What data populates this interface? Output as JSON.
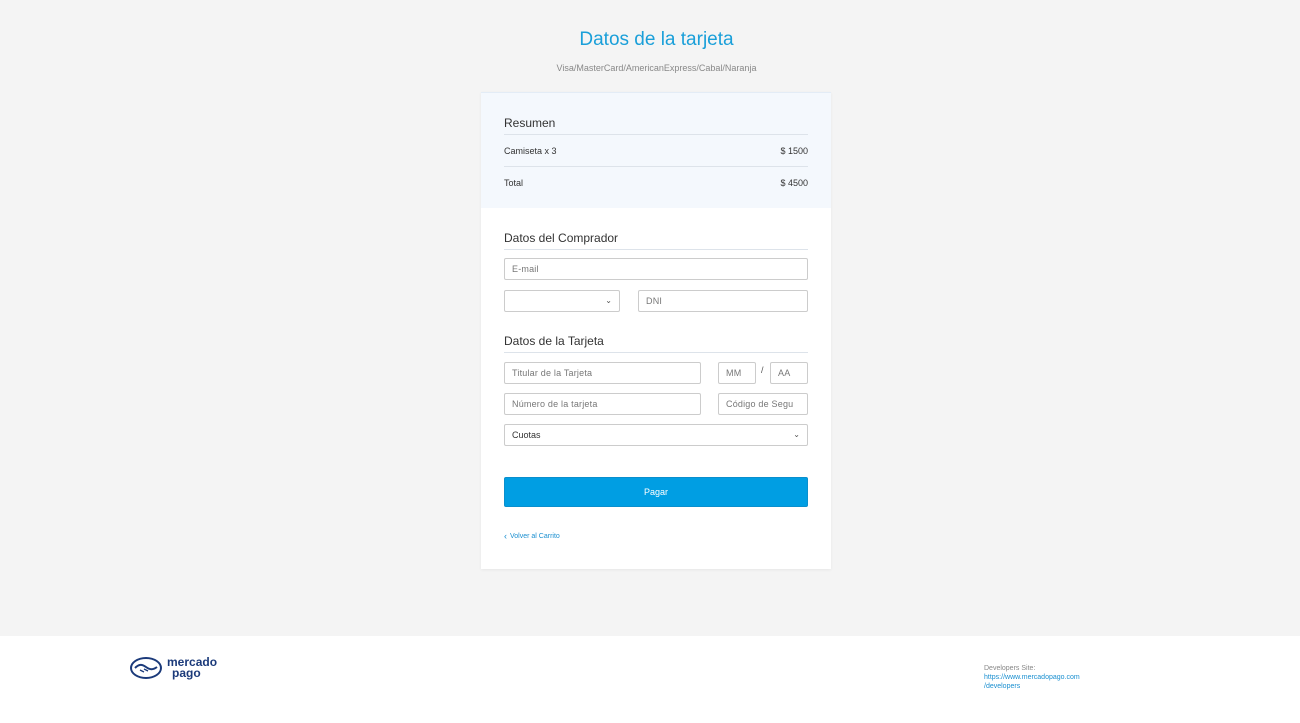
{
  "header": {
    "title": "Datos de la tarjeta",
    "subtitle": "Visa/MasterCard/AmericanExpress/Cabal/Naranja"
  },
  "summary": {
    "title": "Resumen",
    "item_label": "Camiseta x 3",
    "item_value": "$ 1500",
    "total_label": "Total",
    "total_value": "$ 4500"
  },
  "buyer": {
    "title": "Datos del Comprador",
    "email_placeholder": "E-mail",
    "doc_type_value": "",
    "dni_placeholder": "DNI"
  },
  "card": {
    "title": "Datos de la Tarjeta",
    "holder_placeholder": "Titular de la Tarjeta",
    "month_placeholder": "MM",
    "slash": "/",
    "year_placeholder": "AA",
    "number_placeholder": "Número de la tarjeta",
    "cvv_placeholder": "Código de Segu",
    "installments_value": "Cuotas"
  },
  "actions": {
    "pay_label": "Pagar",
    "back_label": "Volver al Carrito"
  },
  "footer": {
    "logo_line1": "mercado",
    "logo_line2": "pago",
    "dev_label": "Developers Site:",
    "dev_url_line1": "https://www.mercadopago.com",
    "dev_url_line2": "/developers"
  },
  "colors": {
    "accent": "#009ee3",
    "title": "#1a9fd9",
    "brand": "#1b3a7a"
  }
}
